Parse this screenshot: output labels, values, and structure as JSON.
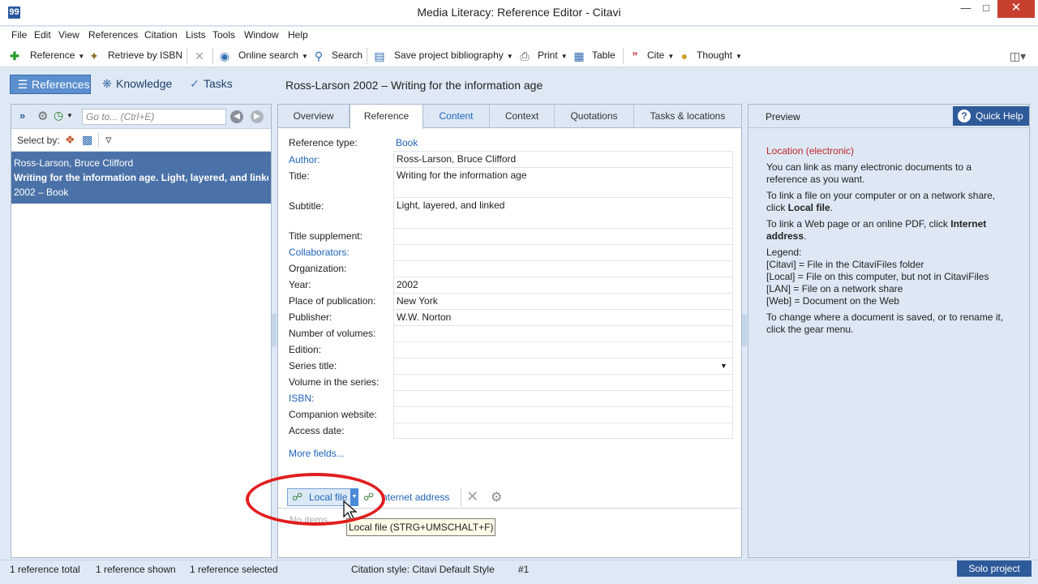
{
  "window": {
    "title": "Media Literacy: Reference Editor - Citavi",
    "icon_glyph": "99"
  },
  "menu": [
    "File",
    "Edit",
    "View",
    "References",
    "Citation",
    "Lists",
    "Tools",
    "Window",
    "Help"
  ],
  "toolbar": {
    "reference": "Reference",
    "retrieve": "Retrieve by ISBN",
    "online_search": "Online search",
    "search": "Search",
    "save_bib": "Save project bibliography",
    "print": "Print",
    "table": "Table",
    "cite": "Cite",
    "thought": "Thought"
  },
  "nav": {
    "references": "References",
    "knowledge": "Knowledge",
    "tasks": "Tasks"
  },
  "reference_heading": "Ross-Larson 2002 – Writing for the information age",
  "left": {
    "goto_placeholder": "Go to... (Ctrl+E)",
    "select_by": "Select by:",
    "selected_item": {
      "authors": "Ross-Larson, Bruce Clifford",
      "title": "Writing for the information age. Light, layered, and linked",
      "meta": "2002 – Book"
    }
  },
  "tabs": [
    "Overview",
    "Reference",
    "Content",
    "Context",
    "Quotations",
    "Tasks & locations"
  ],
  "fields": [
    {
      "label": "Reference type:",
      "value": "Book"
    },
    {
      "label": "Author:",
      "value": "Ross-Larson, Bruce Clifford"
    },
    {
      "label": "Title:",
      "value": "Writing for the information age"
    },
    {
      "label": "Subtitle:",
      "value": "Light, layered, and linked"
    },
    {
      "label": "Title supplement:",
      "value": ""
    },
    {
      "label": "Collaborators:",
      "value": ""
    },
    {
      "label": "Organization:",
      "value": ""
    },
    {
      "label": "Year:",
      "value": "2002"
    },
    {
      "label": "Place of publication:",
      "value": "New York"
    },
    {
      "label": "Publisher:",
      "value": "W.W. Norton"
    },
    {
      "label": "Number of volumes:",
      "value": ""
    },
    {
      "label": "Edition:",
      "value": ""
    },
    {
      "label": "Series title:",
      "value": ""
    },
    {
      "label": "Volume in the series:",
      "value": ""
    },
    {
      "label": "ISBN:",
      "value": ""
    },
    {
      "label": "Companion website:",
      "value": ""
    },
    {
      "label": "Access date:",
      "value": ""
    }
  ],
  "more_fields": "More fields...",
  "locations": {
    "local_file": "Local file",
    "internet_address": "nternet address",
    "no_items": "No items",
    "tooltip": "Local file (STRG+UMSCHALT+F)"
  },
  "preview": {
    "header": "Preview",
    "quick_help": "Quick Help",
    "help_title": "Location (electronic)",
    "p1": "You can link as many electronic documents to a reference as you want.",
    "p2a": "To link a file on your computer or on a network share, click ",
    "p2b": "Local file",
    "p2c": ".",
    "p3a": "To link a Web page or an online PDF, click ",
    "p3b": "Internet address",
    "p3c": ".",
    "legend": "Legend:",
    "l1": "[Citavi] = File in the CitaviFiles folder",
    "l2": "[Local] = File on this computer, but not in CitaviFiles",
    "l3": "[LAN] = File on a network share",
    "l4": "[Web] = Document on the Web",
    "p4": "To change where a document is saved, or to rename it, click the gear menu."
  },
  "status": {
    "total": "1 reference total",
    "shown": "1 reference shown",
    "selected": "1 reference selected",
    "style": "Citation style: Citavi Default Style",
    "number": "#1",
    "project": "Solo project"
  },
  "colors": {
    "accent": "#2e5a99",
    "selection": "#4b72a8",
    "link": "#1f63b8",
    "highlight_oval": "#e01e1e"
  }
}
